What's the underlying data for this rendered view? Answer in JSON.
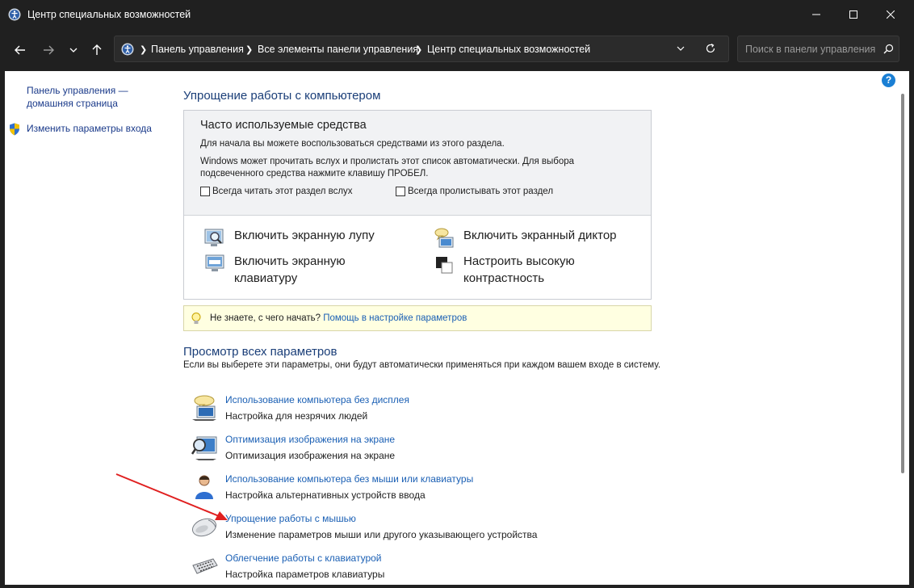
{
  "window": {
    "title": "Центр специальных возможностей",
    "minimize": "—",
    "maximize": "☐",
    "close": "✕"
  },
  "nav": {
    "breadcrumbs": [
      "Панель управления",
      "Все элементы панели управления",
      "Центр специальных возможностей"
    ],
    "search_placeholder": "Поиск в панели управления"
  },
  "sidebar": {
    "home_line1": "Панель управления —",
    "home_line2": "домашняя страница",
    "signin": "Изменить параметры входа"
  },
  "main": {
    "section1_title": "Упрощение работы с компьютером",
    "box": {
      "heading": "Часто используемые средства",
      "text1": "Для начала вы можете воспользоваться средствами из этого раздела.",
      "text2a": "Windows может прочитать вслух и пролистать этот список автоматически. Для выбора",
      "text2b": "подсвеченного средства нажмите клавишу ПРОБЕЛ.",
      "cb1": "Всегда читать этот раздел вслух",
      "cb2": "Всегда пролистывать этот раздел",
      "tools": {
        "magnifier": "Включить экранную лупу",
        "narrator": "Включить экранный диктор",
        "keyboard1": "Включить экранную",
        "keyboard2": "клавиатуру",
        "contrast1": "Настроить высокую",
        "contrast2": "контрастность"
      }
    },
    "tip": {
      "text": "Не знаете, с чего начать? ",
      "link": "Помощь в настройке параметров"
    },
    "section2_title": "Просмотр всех параметров",
    "section2_desc": "Если вы выберете эти параметры, они будут автоматически применяться при каждом вашем входе в систему.",
    "items": [
      {
        "link": "Использование компьютера без дисплея",
        "sub": "Настройка для незрячих людей",
        "icon": "speech-monitor-icon"
      },
      {
        "link": "Оптимизация изображения на экране",
        "sub": "Оптимизация изображения на экране",
        "icon": "magnify-monitor-icon"
      },
      {
        "link": "Использование компьютера без мыши или клавиатуры",
        "sub": "Настройка альтернативных устройств ввода",
        "icon": "user-icon"
      },
      {
        "link": "Упрощение работы с мышью",
        "sub": "Изменение параметров мыши или другого указывающего устройства",
        "icon": "mouse-icon"
      },
      {
        "link": "Облегчение работы с клавиатурой",
        "sub": "Настройка параметров клавиатуры",
        "icon": "keyboard-icon"
      }
    ]
  },
  "colors": {
    "accent": "#1a5fb4",
    "annotation_arrow": "#e02020"
  }
}
